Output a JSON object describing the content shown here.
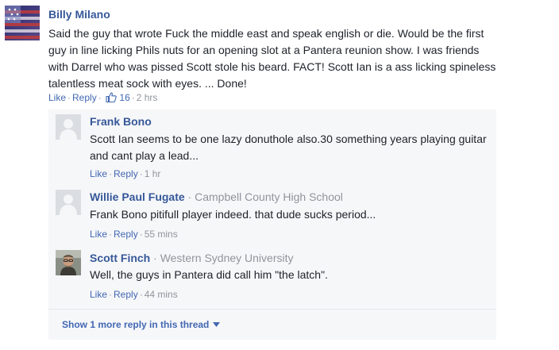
{
  "top_comment": {
    "author": "Billy Milano",
    "text": "Said the guy that wrote Fuck the middle east and speak english or die. Would be the first guy in line licking Phils nuts for an opening slot at a Pantera reunion show. I was friends with Darrel who was pissed Scott stole his beard. FACT! Scott Ian is a ass licking spineless talentless meat sock with eyes. ... Done!",
    "like": "Like",
    "reply": "Reply",
    "likes": "16",
    "time": "2 hrs"
  },
  "replies": [
    {
      "author": "Frank Bono",
      "affiliation": "",
      "text": "Scott Ian seems to be one lazy donuthole also.30 something years playing guitar and cant play a lead...",
      "like": "Like",
      "reply": "Reply",
      "time": "1 hr"
    },
    {
      "author": "Willie Paul Fugate",
      "affiliation": "Campbell County High School",
      "text": "Frank Bono pitifull player indeed. that dude sucks period...",
      "like": "Like",
      "reply": "Reply",
      "time": "55 mins"
    },
    {
      "author": "Scott Finch",
      "affiliation": "Western Sydney University",
      "text": "Well, the guys in Pantera did call him \"the latch\".",
      "like": "Like",
      "reply": "Reply",
      "time": "44 mins"
    }
  ],
  "more_replies": "Show 1 more reply in this thread",
  "colors": {
    "link": "#4267b2",
    "name": "#365899",
    "meta": "#90949c",
    "thread_bg": "#f6f7f9"
  },
  "icons": [
    "flag-avatar",
    "default-avatar",
    "photo-avatar",
    "thumbs-up-icon",
    "caret-down-icon"
  ]
}
